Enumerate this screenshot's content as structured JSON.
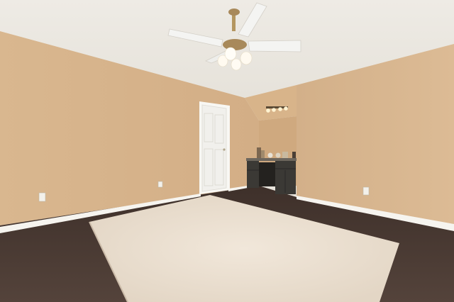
{
  "scene": {
    "description_tag": "empty-bonus-room-photo",
    "colors": {
      "ceiling": "#ebe8e1",
      "wall_left": "#d8b58d",
      "wall_right": "#d6b48c",
      "wall_back": "#d2ad84",
      "alcove_wall": "#cfa97f",
      "trim": "#f6f4ef",
      "door": "#f3f2ee",
      "carpet": "#4a3a33",
      "rug": "#ece1d3",
      "cabinet": "#3b3935",
      "fan_blade": "#f4f4f2",
      "fan_brass": "#b49660"
    }
  }
}
